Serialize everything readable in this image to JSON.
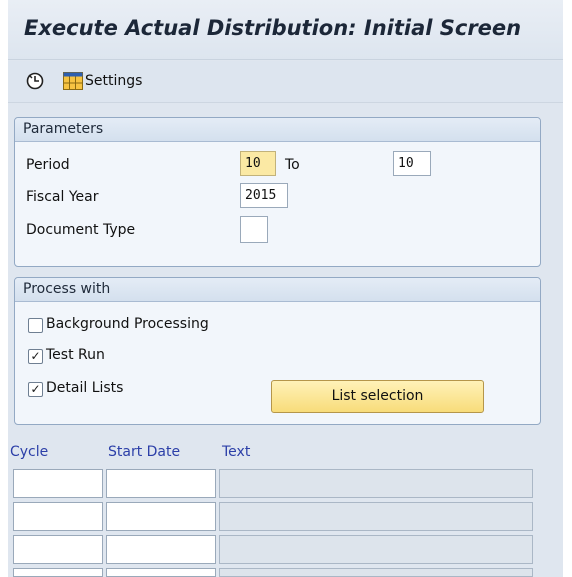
{
  "title": "Execute Actual Distribution: Initial Screen",
  "toolbar": {
    "execute_icon": "execute-clock-icon",
    "settings_icon": "table-settings-icon",
    "settings_label": "Settings"
  },
  "parameters": {
    "header": "Parameters",
    "period_label": "Period",
    "period_from": "10",
    "to_label": "To",
    "period_to": "10",
    "fiscal_year_label": "Fiscal Year",
    "fiscal_year": "2015",
    "document_type_label": "Document Type",
    "document_type": ""
  },
  "process": {
    "header": "Process with",
    "background_label": "Background Processing",
    "background_checked": false,
    "test_run_label": "Test Run",
    "test_run_checked": true,
    "detail_lists_label": "Detail Lists",
    "detail_lists_checked": true,
    "list_selection_label": "List selection"
  },
  "cycles": {
    "columns": [
      "Cycle",
      "Start Date",
      "Text"
    ],
    "rows": [
      {
        "cycle": "",
        "start_date": "",
        "text": ""
      },
      {
        "cycle": "",
        "start_date": "",
        "text": ""
      },
      {
        "cycle": "",
        "start_date": "",
        "text": ""
      },
      {
        "cycle": "",
        "start_date": "",
        "text": ""
      }
    ]
  },
  "colors": {
    "required_field": "#fbe9a4",
    "header_link_blue": "#2c3fa8",
    "frame_bg": "#dfe6ef"
  }
}
